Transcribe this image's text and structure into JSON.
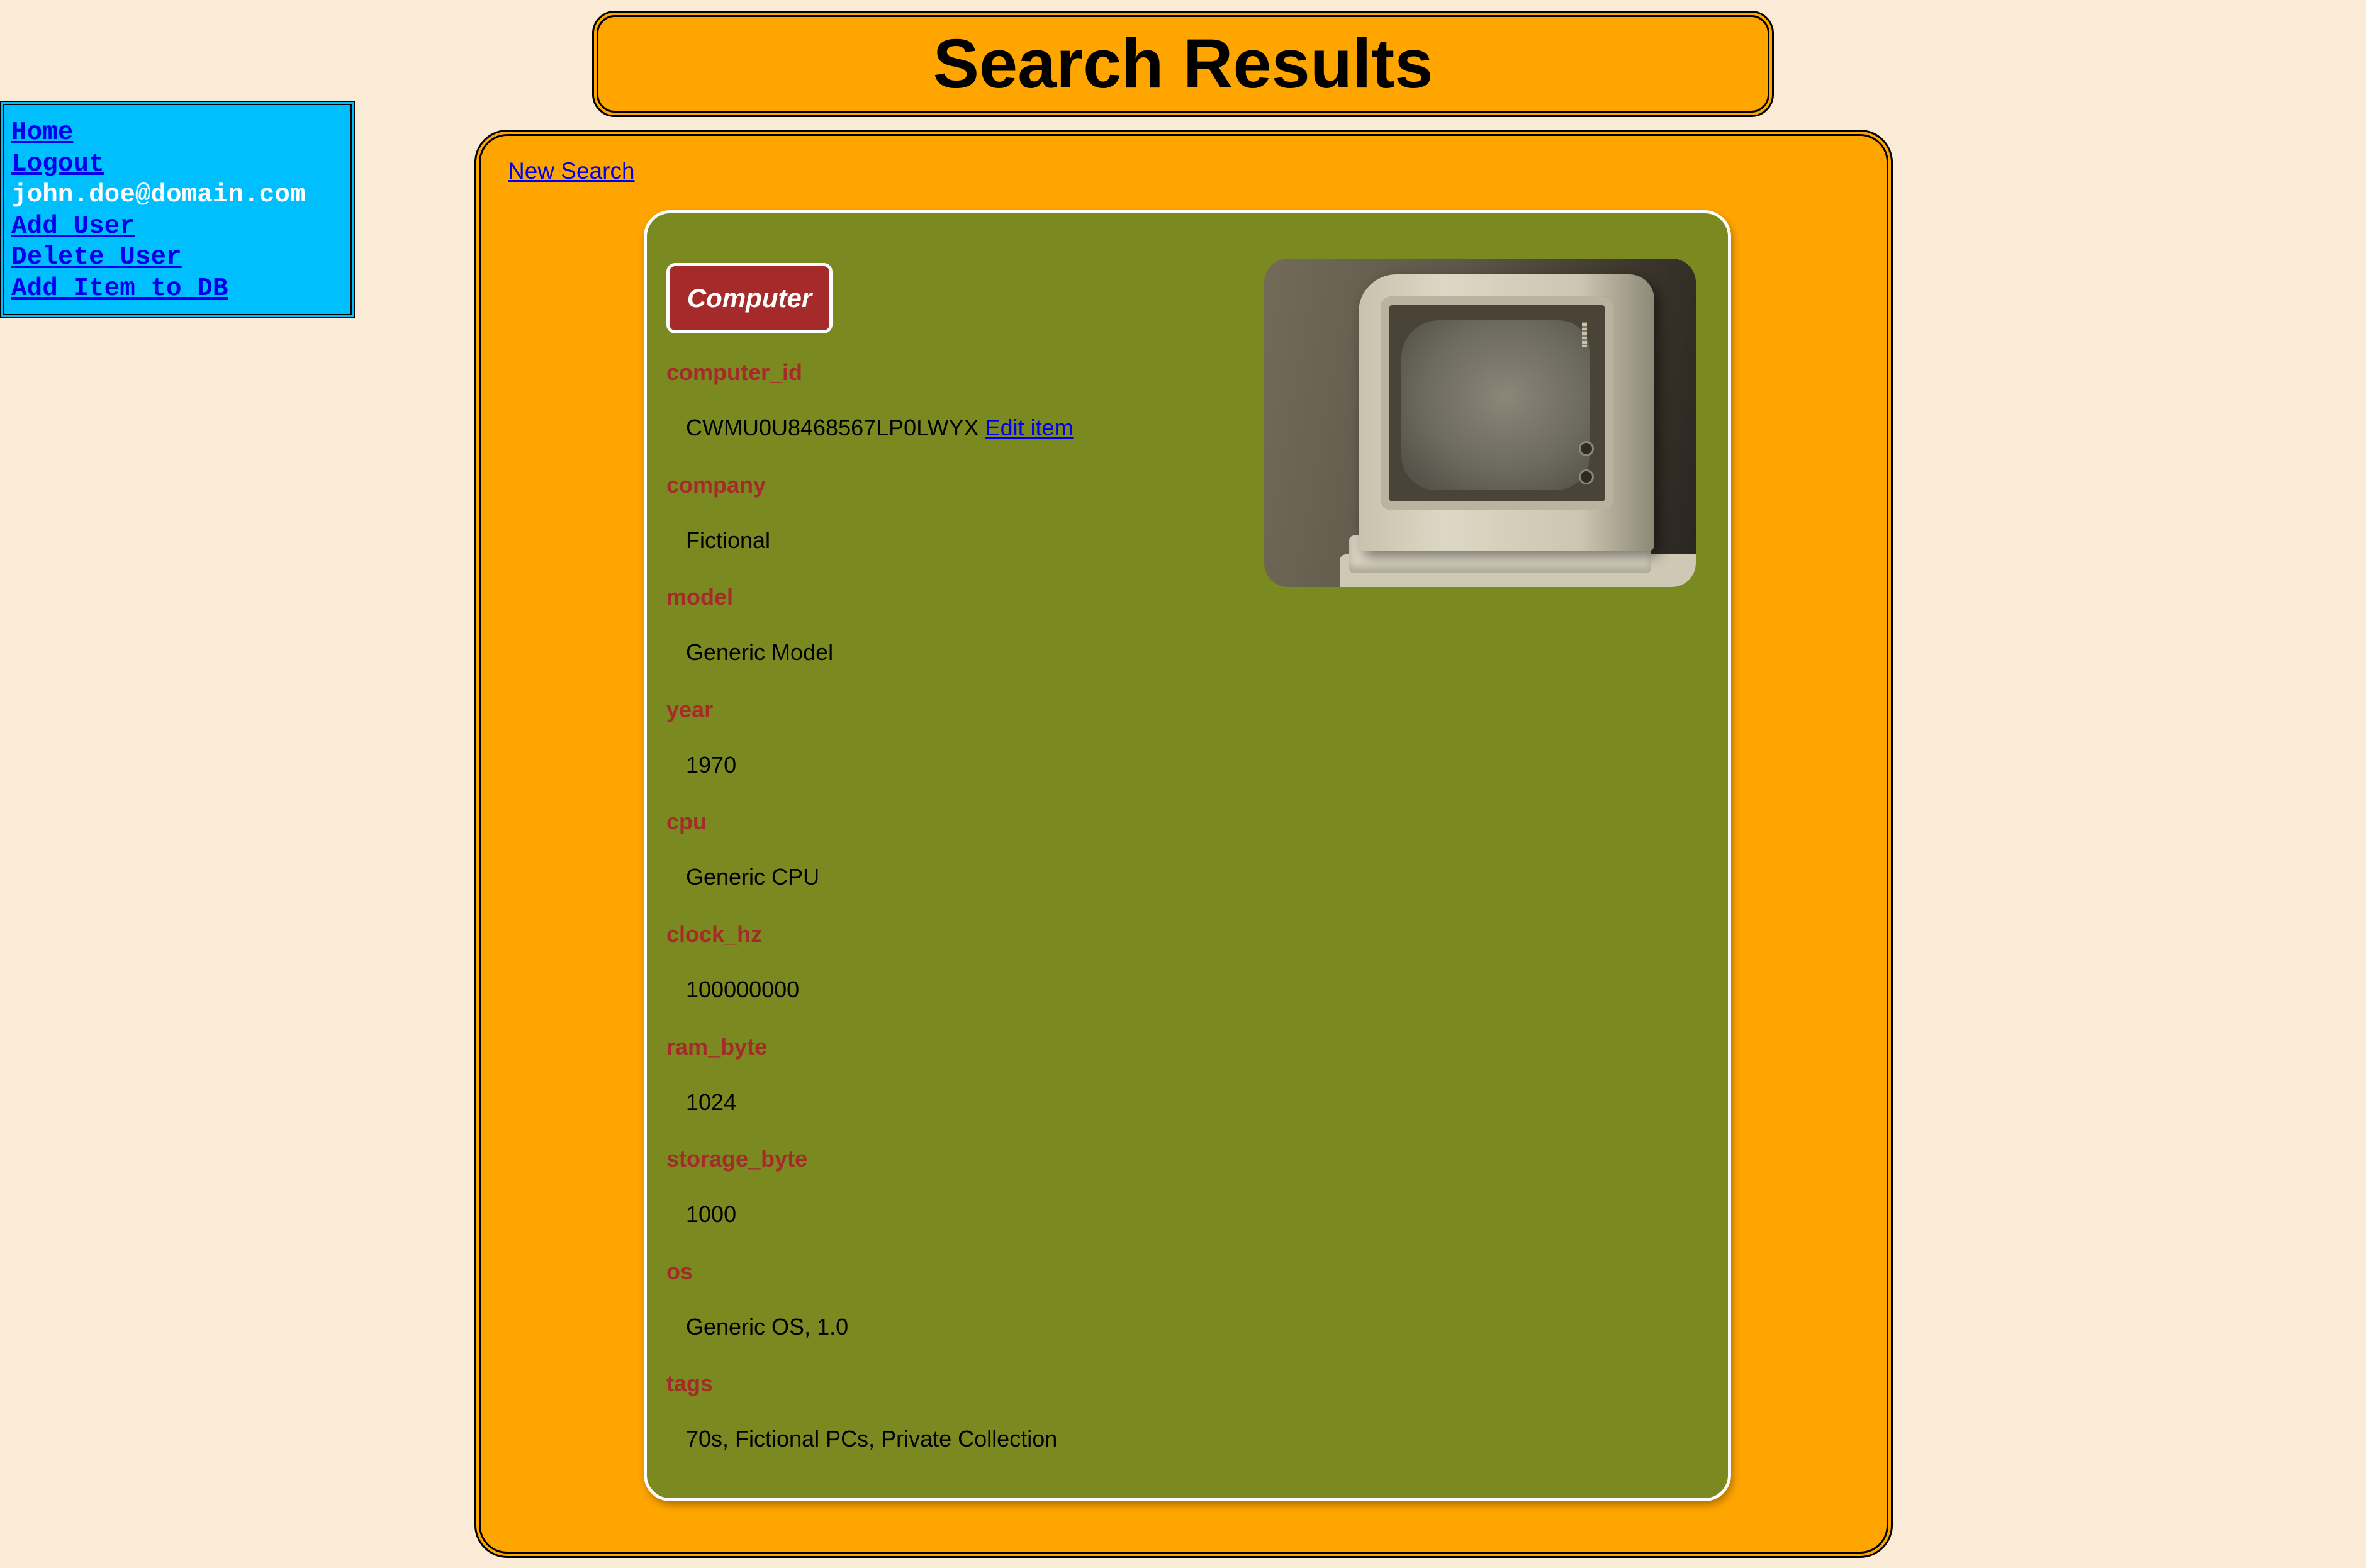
{
  "header": {
    "title": "Search Results"
  },
  "nav": {
    "home": "Home",
    "logout": "Logout",
    "user_email": "john.doe@domain.com",
    "add_user": "Add User",
    "delete_user": "Delete User",
    "add_item": "Add Item to DB"
  },
  "main": {
    "new_search": "New Search"
  },
  "card": {
    "title": "Computer",
    "edit_label": "Edit item",
    "fields": [
      {
        "label": "computer_id",
        "value": "CWMU0U8468567LP0LWYX"
      },
      {
        "label": "company",
        "value": "Fictional"
      },
      {
        "label": "model",
        "value": "Generic Model"
      },
      {
        "label": "year",
        "value": "1970"
      },
      {
        "label": "cpu",
        "value": "Generic CPU"
      },
      {
        "label": "clock_hz",
        "value": "100000000"
      },
      {
        "label": "ram_byte",
        "value": "1024"
      },
      {
        "label": "storage_byte",
        "value": "1000"
      },
      {
        "label": "os",
        "value": "Generic OS, 1.0"
      },
      {
        "label": "tags",
        "value": "70s, Fictional PCs, Private Collection"
      }
    ]
  },
  "colors": {
    "page_background": "#faebd7",
    "header_background": "#ffa500",
    "nav_background": "#00bfff",
    "card_background": "#7b8921",
    "label_color": "#a52a2a",
    "link_color": "#0000ee"
  }
}
